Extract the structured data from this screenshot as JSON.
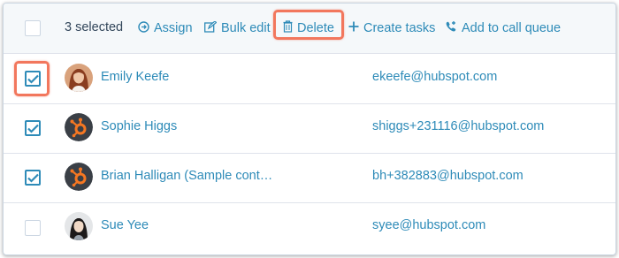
{
  "toolbar": {
    "selected_count": "3 selected",
    "assign_label": "Assign",
    "bulk_edit_label": "Bulk edit",
    "delete_label": "Delete",
    "create_tasks_label": "Create tasks",
    "call_queue_label": "Add to call queue",
    "icons": [
      "assign-icon",
      "edit-icon",
      "trash-icon",
      "plus-icon",
      "phone-icon"
    ]
  },
  "colors": {
    "link": "#2e8bb8",
    "highlight": "#f2775d",
    "hubspot_orange": "#f57722",
    "hubspot_avatar_bg": "#3a3f46"
  },
  "contacts": [
    {
      "name": "Emily Keefe",
      "email": "ekeefe@hubspot.com",
      "checked": true,
      "avatar": "photo-avatar"
    },
    {
      "name": "Sophie Higgs",
      "email": "shiggs+231116@hubspot.com",
      "checked": true,
      "avatar": "hubspot-logo-avatar"
    },
    {
      "name": "Brian Halligan (Sample cont…",
      "email": "bh+382883@hubspot.com",
      "checked": true,
      "avatar": "hubspot-logo-avatar"
    },
    {
      "name": "Sue Yee",
      "email": "syee@hubspot.com",
      "checked": false,
      "avatar": "photo-avatar"
    }
  ]
}
